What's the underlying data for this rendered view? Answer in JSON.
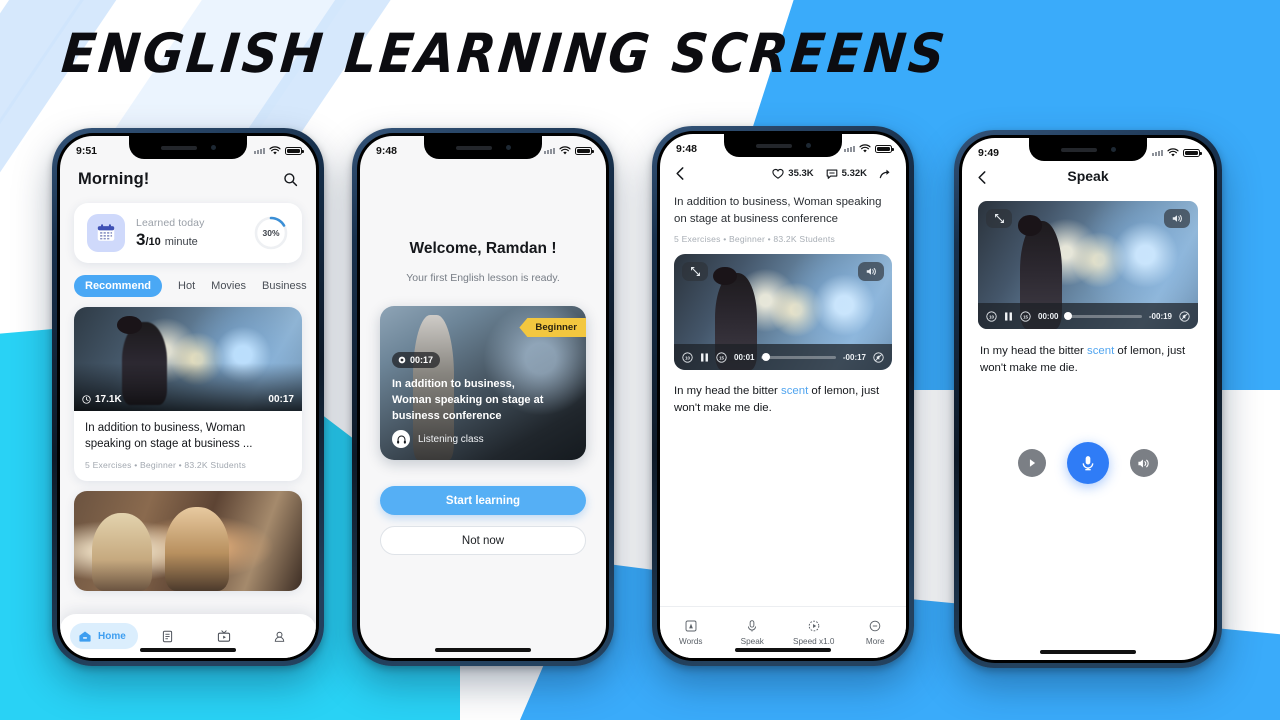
{
  "poster": {
    "title": "ENGLISH LEARNING SCREENS",
    "accent": "#3aabfa",
    "cyan": "#29d2f5"
  },
  "phone1": {
    "status": {
      "time": "9:51",
      "wifi_icon": "wifi-icon",
      "battery_icon": "battery-icon"
    },
    "greeting": "Morning!",
    "search_icon": "search-icon",
    "progress_card": {
      "calendar_icon": "calendar-icon",
      "label": "Learned today",
      "value": "3",
      "denominator": "/10",
      "unit": "minute",
      "percent": "30%",
      "percent_value": 30
    },
    "tabs": [
      {
        "label": "Recommend",
        "active": true
      },
      {
        "label": "Hot",
        "active": false
      },
      {
        "label": "Movies",
        "active": false
      },
      {
        "label": "Business",
        "active": false
      }
    ],
    "cards": [
      {
        "views": "17.1K",
        "views_icon": "eye-icon",
        "duration": "00:17",
        "title": "In addition to business, Woman speaking on stage at business ...",
        "meta": "5 Exercises • Beginner • 83.2K Students"
      }
    ],
    "nav": [
      {
        "label": "Home",
        "icon": "home-icon",
        "active": true
      },
      {
        "label": "",
        "icon": "document-icon",
        "active": false
      },
      {
        "label": "",
        "icon": "tv-icon",
        "active": false
      },
      {
        "label": "",
        "icon": "profile-icon",
        "active": false
      }
    ]
  },
  "phone2": {
    "status": {
      "time": "9:48"
    },
    "welcome": "Welcome, Ramdan !",
    "subtitle": "Your first English lesson is ready.",
    "lesson_card": {
      "ribbon": "Beginner",
      "duration": "00:17",
      "duration_icon": "clock-icon",
      "title": "In addition to business, Woman speaking on stage at business conference",
      "class_type": "Listening class",
      "class_icon": "headphones-icon"
    },
    "primary_button": "Start learning",
    "secondary_button": "Not now"
  },
  "phone3": {
    "status": {
      "time": "9:48"
    },
    "back_icon": "chevron-left-icon",
    "actions": [
      {
        "icon": "heart-icon",
        "count": "35.3K"
      },
      {
        "icon": "comment-icon",
        "count": "5.32K"
      },
      {
        "icon": "share-icon",
        "count": ""
      }
    ],
    "title": "In addition to business, Woman speaking on stage at business conference",
    "meta": "5 Exercises • Beginner • 83.2K Students",
    "player": {
      "expand_icon": "expand-icon",
      "volume_icon": "volume-icon",
      "rewind_icon": "rewind-10-icon",
      "pause_icon": "pause-icon",
      "forward_icon": "forward-15-icon",
      "current_time": "00:01",
      "remaining_time": "-00:17",
      "mute_icon": "mute-icon",
      "progress_percent": 6
    },
    "caption": {
      "before": "In my head the bitter ",
      "highlight": "scent",
      "after": " of lemon, just won't make me die."
    },
    "bottom_nav": [
      {
        "label": "Words",
        "icon": "words-icon"
      },
      {
        "label": "Speak",
        "icon": "mic-icon"
      },
      {
        "label": "Speed x1.0",
        "icon": "speed-icon"
      },
      {
        "label": "More",
        "icon": "more-icon"
      }
    ]
  },
  "phone4": {
    "status": {
      "time": "9:49"
    },
    "back_icon": "chevron-left-icon",
    "title": "Speak",
    "player": {
      "expand_icon": "expand-icon",
      "volume_icon": "volume-icon",
      "rewind_icon": "rewind-10-icon",
      "pause_icon": "pause-icon",
      "forward_icon": "forward-15-icon",
      "current_time": "00:00",
      "remaining_time": "-00:19",
      "mute_icon": "mute-icon",
      "progress_percent": 3
    },
    "caption": {
      "before": "In my head the bitter ",
      "highlight": "scent",
      "after": " of lemon, just won't make me die."
    },
    "actions": [
      {
        "icon": "play-icon",
        "name": "play-button"
      },
      {
        "icon": "mic-icon",
        "name": "record-button"
      },
      {
        "icon": "speaker-icon",
        "name": "listen-button"
      }
    ]
  }
}
